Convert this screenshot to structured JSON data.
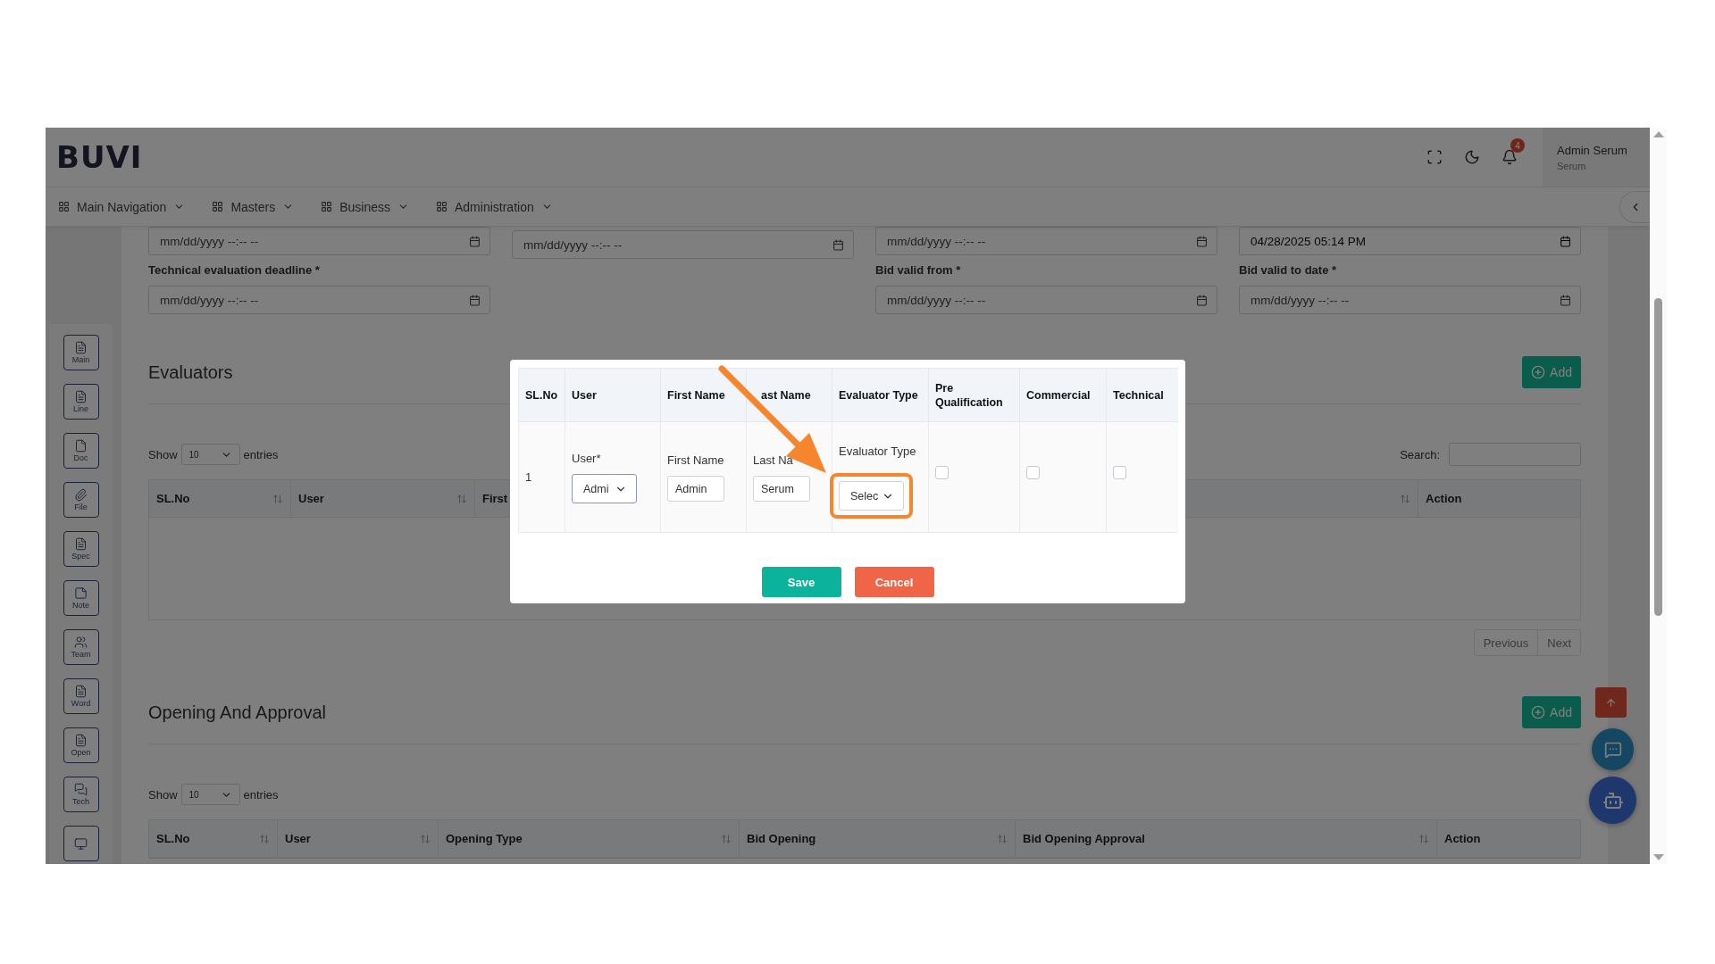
{
  "header": {
    "logo": "BUVI",
    "notification_count": "4",
    "user_name": "Admin Serum",
    "user_role": "Serum"
  },
  "nav": [
    {
      "label": "Main Navigation"
    },
    {
      "label": "Masters"
    },
    {
      "label": "Business"
    },
    {
      "label": "Administration"
    }
  ],
  "sidebar": [
    {
      "label": "Main",
      "kind": "list"
    },
    {
      "label": "Line",
      "kind": "list"
    },
    {
      "label": "Doc",
      "kind": "page"
    },
    {
      "label": "File",
      "kind": "clip"
    },
    {
      "label": "Spec",
      "kind": "list"
    },
    {
      "label": "Note",
      "kind": "note"
    },
    {
      "label": "Team",
      "kind": "team"
    },
    {
      "label": "Word",
      "kind": "list"
    },
    {
      "label": "Open",
      "kind": "list"
    },
    {
      "label": "Tech",
      "kind": "chat"
    },
    {
      "kind": "screen"
    }
  ],
  "date_rows": [
    [
      {
        "kind": "field",
        "placeholder": "mm/dd/yyyy --:-- --"
      },
      {
        "kind": "field",
        "placeholder": "mm/dd/yyyy --:-- --"
      },
      {
        "kind": "field",
        "placeholder": "mm/dd/yyyy --:-- --"
      },
      {
        "kind": "field",
        "value": "04/28/2025 05:14 PM"
      }
    ],
    [
      {
        "kind": "field",
        "label": "Technical evaluation deadline *",
        "placeholder": "mm/dd/yyyy --:-- --"
      },
      {
        "kind": "blank"
      },
      {
        "kind": "field",
        "label": "Bid valid from *",
        "placeholder": "mm/dd/yyyy --:-- --"
      },
      {
        "kind": "field",
        "label": "Bid valid to date *",
        "placeholder": "mm/dd/yyyy --:-- --"
      }
    ]
  ],
  "sections": [
    {
      "title": "Evaluators",
      "add_button": "Add",
      "show_label": "Show",
      "entries_value": "10",
      "entries_label": "entries",
      "search_label": "Search:",
      "columns": [
        {
          "label": "SL.No",
          "sortable": true
        },
        {
          "label": "User",
          "sortable": true
        },
        {
          "label": "First",
          "sortable": false
        },
        {
          "sortable": true
        },
        {
          "label": "Action",
          "sortable": false
        }
      ],
      "pagination": [
        "Previous",
        "Next"
      ]
    },
    {
      "title": "Opening And Approval",
      "add_button": "Add",
      "show_label": "Show",
      "entries_value": "10",
      "entries_label": "entries",
      "columns": [
        {
          "label": "SL.No",
          "sortable": true
        },
        {
          "label": "User",
          "sortable": true
        },
        {
          "label": "Opening Type",
          "sortable": true
        },
        {
          "label": "Bid Opening",
          "sortable": true
        },
        {
          "label": "Bid Opening Approval",
          "sortable": true
        },
        {
          "label": "Action",
          "sortable": false
        }
      ]
    }
  ],
  "floating_buttons": [
    {
      "kind": "scroll_top"
    },
    {
      "kind": "chat"
    },
    {
      "kind": "bot"
    }
  ],
  "modal": {
    "columns": [
      "SL.No",
      "User",
      "First Name",
      "ast Name",
      "Evaluator Type",
      "Pre Qualification",
      "Commercial",
      "Technical"
    ],
    "row": {
      "sl_no": "1",
      "cells": [
        {
          "kind": "select",
          "label": "User*",
          "value": "Admi",
          "highlighted": false
        },
        {
          "kind": "input",
          "label": "First Name",
          "value": "Admin"
        },
        {
          "kind": "input",
          "label": "Last Na",
          "value": "Serum"
        },
        {
          "kind": "select",
          "label": "Evaluator Type",
          "value": "Selec",
          "highlighted": true
        },
        {
          "kind": "checkbox",
          "checked": false
        },
        {
          "kind": "checkbox",
          "checked": false
        },
        {
          "kind": "checkbox",
          "checked": false
        }
      ]
    },
    "buttons": [
      {
        "label": "Save",
        "kind": "primary"
      },
      {
        "label": "Cancel",
        "kind": "danger"
      }
    ]
  }
}
